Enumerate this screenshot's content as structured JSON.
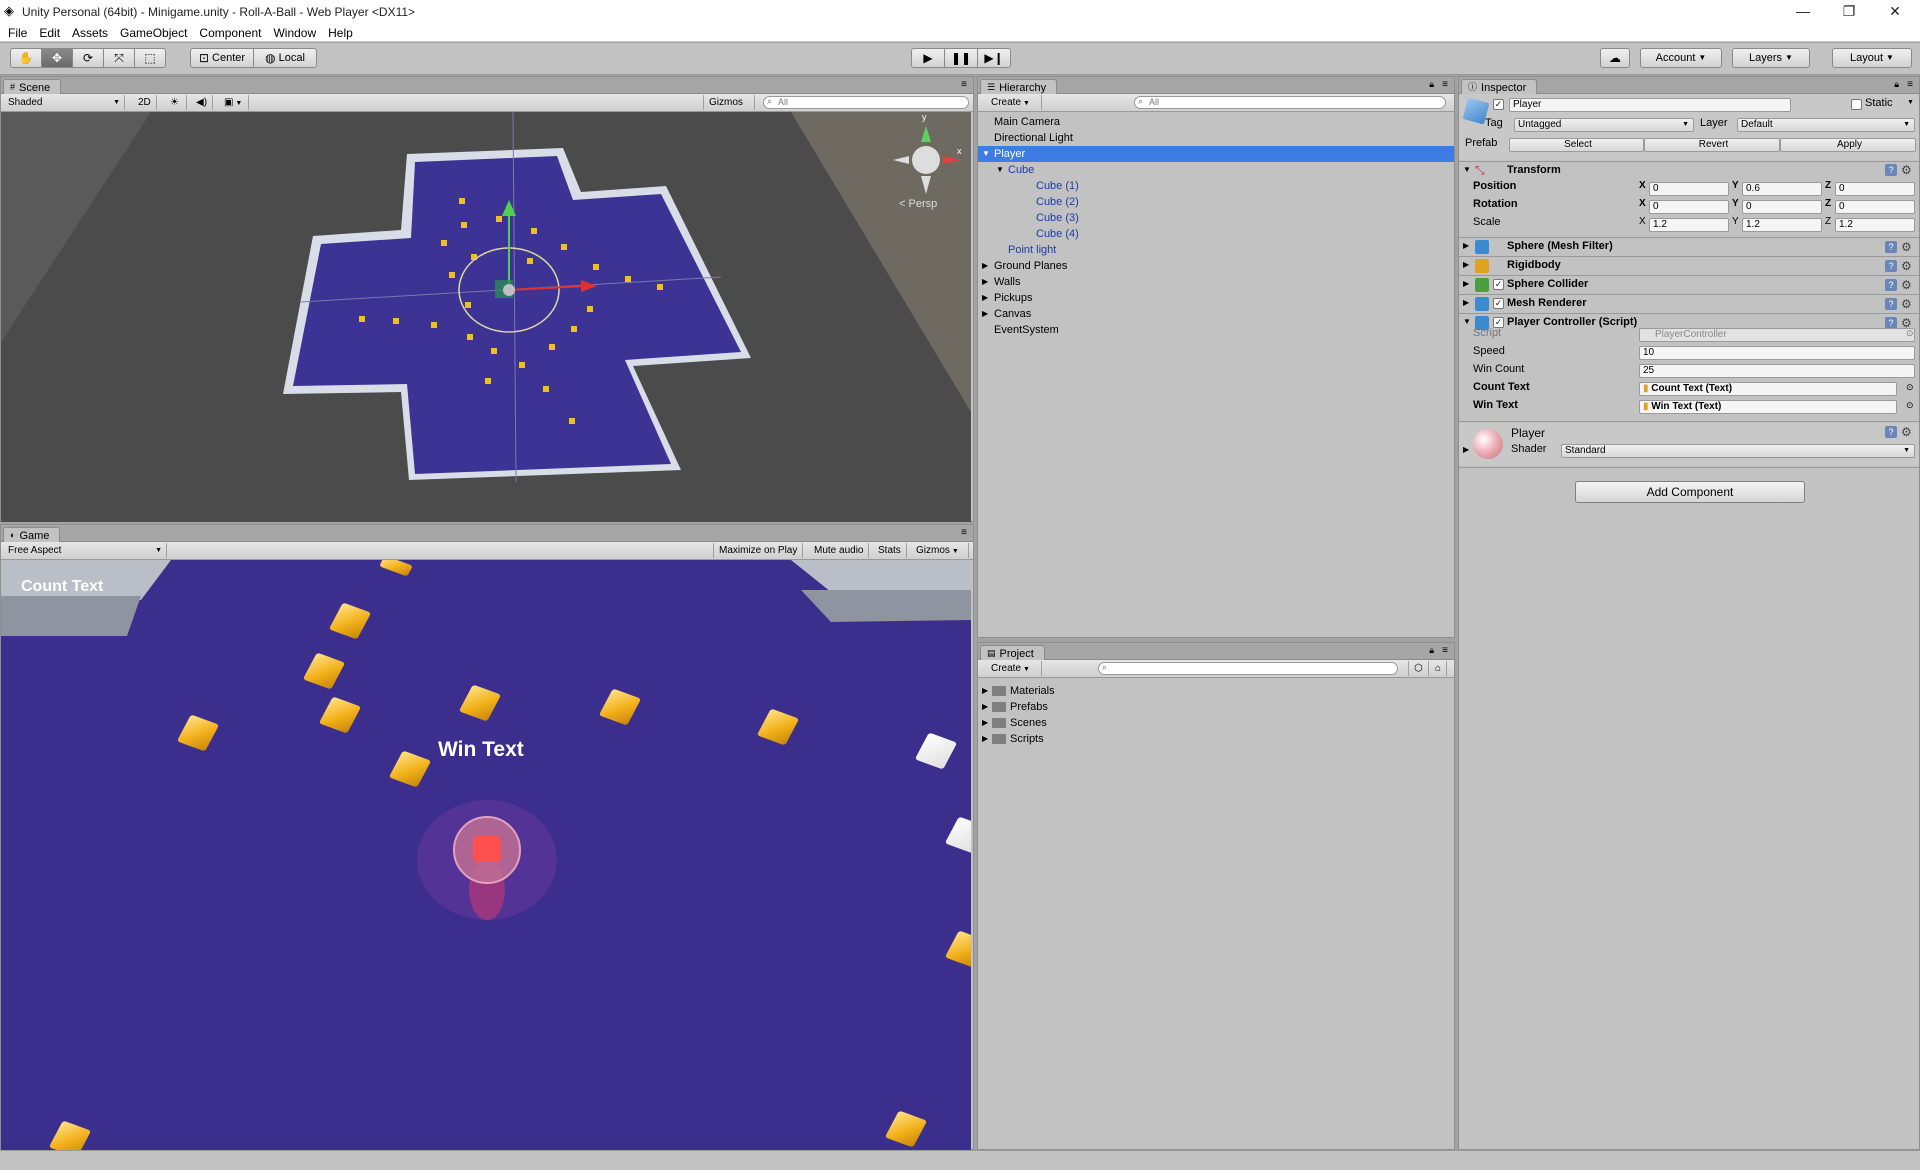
{
  "window": {
    "title": "Unity Personal (64bit) - Minigame.unity - Roll-A-Ball - Web Player <DX11>",
    "minimize": "—",
    "maximize": "❐",
    "close": "✕"
  },
  "menu": [
    "File",
    "Edit",
    "Assets",
    "GameObject",
    "Component",
    "Window",
    "Help"
  ],
  "toolbar": {
    "pivot": "Center",
    "space": "Local",
    "account": "Account",
    "layers": "Layers",
    "layout": "Layout"
  },
  "scene": {
    "tab": "Scene",
    "shading": "Shaded",
    "mode2d": "2D",
    "gizmos": "Gizmos",
    "search_placeholder": "All",
    "persp": "Persp",
    "axis_y": "y",
    "axis_x": "x"
  },
  "game": {
    "tab": "Game",
    "aspect": "Free Aspect",
    "maximize": "Maximize on Play",
    "mute": "Mute audio",
    "stats": "Stats",
    "gizmos": "Gizmos",
    "count_text": "Count Text",
    "win_text": "Win Text"
  },
  "hierarchy": {
    "tab": "Hierarchy",
    "create": "Create",
    "search_placeholder": "All",
    "items": [
      {
        "label": "Main Camera",
        "indent": 0,
        "arrow": "",
        "selected": false,
        "prefab": false
      },
      {
        "label": "Directional Light",
        "indent": 0,
        "arrow": "",
        "selected": false,
        "prefab": false
      },
      {
        "label": "Player",
        "indent": 0,
        "arrow": "▼",
        "selected": true,
        "prefab": true
      },
      {
        "label": "Cube",
        "indent": 1,
        "arrow": "▼",
        "selected": false,
        "prefab": true
      },
      {
        "label": "Cube (1)",
        "indent": 2,
        "arrow": "",
        "selected": false,
        "prefab": true
      },
      {
        "label": "Cube (2)",
        "indent": 2,
        "arrow": "",
        "selected": false,
        "prefab": true
      },
      {
        "label": "Cube (3)",
        "indent": 2,
        "arrow": "",
        "selected": false,
        "prefab": true
      },
      {
        "label": "Cube (4)",
        "indent": 2,
        "arrow": "",
        "selected": false,
        "prefab": true
      },
      {
        "label": "Point light",
        "indent": 1,
        "arrow": "",
        "selected": false,
        "prefab": true
      },
      {
        "label": "Ground Planes",
        "indent": 0,
        "arrow": "▶",
        "selected": false,
        "prefab": false
      },
      {
        "label": "Walls",
        "indent": 0,
        "arrow": "▶",
        "selected": false,
        "prefab": false
      },
      {
        "label": "Pickups",
        "indent": 0,
        "arrow": "▶",
        "selected": false,
        "prefab": false
      },
      {
        "label": "Canvas",
        "indent": 0,
        "arrow": "▶",
        "selected": false,
        "prefab": false
      },
      {
        "label": "EventSystem",
        "indent": 0,
        "arrow": "",
        "selected": false,
        "prefab": false
      }
    ]
  },
  "project": {
    "tab": "Project",
    "create": "Create",
    "folders": [
      "Materials",
      "Prefabs",
      "Scenes",
      "Scripts"
    ]
  },
  "inspector": {
    "tab": "Inspector",
    "name": "Player",
    "static": "Static",
    "tag_label": "Tag",
    "tag": "Untagged",
    "layer_label": "Layer",
    "layer": "Default",
    "prefab_label": "Prefab",
    "prefab_select": "Select",
    "prefab_revert": "Revert",
    "prefab_apply": "Apply",
    "transform": {
      "title": "Transform",
      "position_label": "Position",
      "position": {
        "x": "0",
        "y": "0.6",
        "z": "0"
      },
      "rotation_label": "Rotation",
      "rotation": {
        "x": "0",
        "y": "0",
        "z": "0"
      },
      "scale_label": "Scale",
      "scale": {
        "x": "1.2",
        "y": "1.2",
        "z": "1.2"
      },
      "x": "X",
      "y": "Y",
      "z": "Z"
    },
    "components": [
      "Sphere (Mesh Filter)",
      "Rigidbody",
      "Sphere Collider",
      "Mesh Renderer",
      "Player Controller (Script)"
    ],
    "script": {
      "script_label": "Script",
      "script_value": "PlayerController",
      "speed_label": "Speed",
      "speed": "10",
      "wincount_label": "Win Count",
      "wincount": "25",
      "counttext_label": "Count Text",
      "counttext": "Count Text (Text)",
      "wintext_label": "Win Text",
      "wintext": "Win Text (Text)"
    },
    "material": {
      "name": "Player",
      "shader_label": "Shader",
      "shader": "Standard"
    },
    "add_component": "Add Component"
  }
}
